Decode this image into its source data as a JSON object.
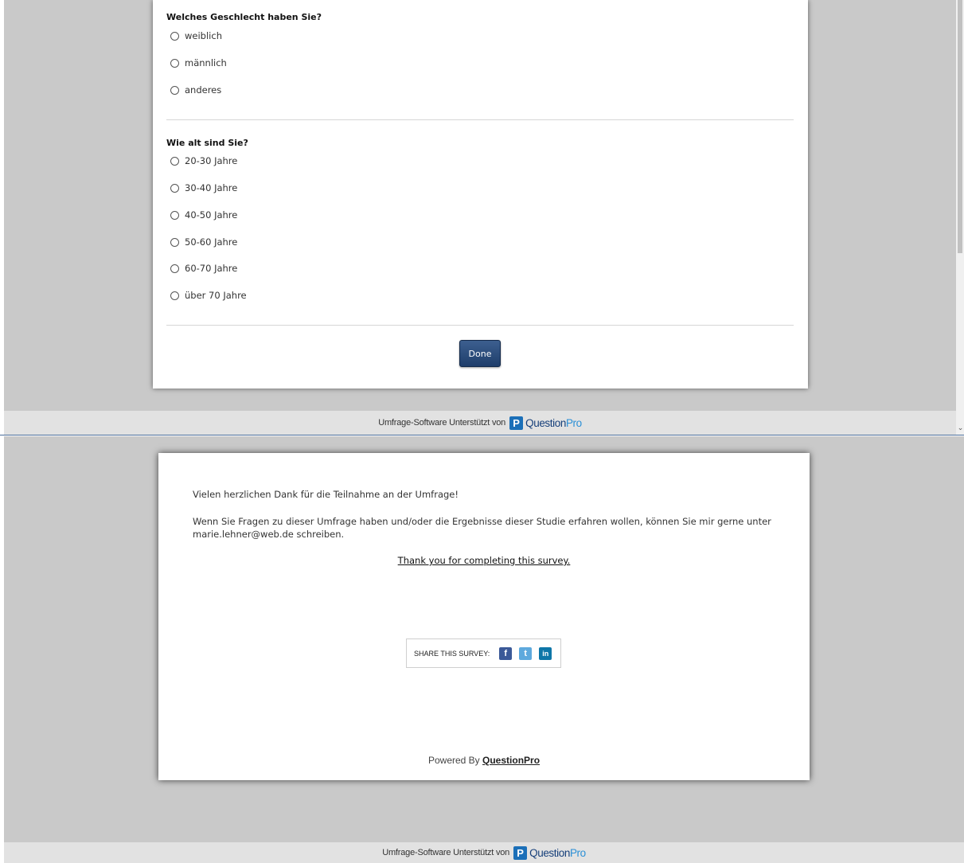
{
  "survey": {
    "gender_question": {
      "title": "Welches Geschlecht haben Sie?",
      "options": [
        "weiblich",
        "männlich",
        "anderes"
      ]
    },
    "age_question": {
      "title": "Wie alt sind Sie?",
      "options": [
        "20-30 Jahre",
        "30-40 Jahre",
        "40-50 Jahre",
        "50-60 Jahre",
        "60-70 Jahre",
        "über 70 Jahre"
      ]
    },
    "done_label": "Done"
  },
  "footer": {
    "text": "Umfrage-Software Unterstützt von",
    "logo_badge": "P",
    "logo_question": "Question",
    "logo_pro": "Pro"
  },
  "thanks": {
    "line1": "Vielen herzlichen Dank für die Teilnahme an der Umfrage!",
    "line2": "Wenn Sie Fragen zu dieser Umfrage haben und/oder die Ergebnisse dieser Studie erfahren wollen, können Sie mir gerne unter",
    "line3": "marie.lehner@web.de schreiben.",
    "completed_link": "Thank you for completing this survey.",
    "share_label": "SHARE THIS SURVEY:",
    "social": [
      {
        "icon": "facebook-icon",
        "glyph": "f",
        "color": "#3b5998"
      },
      {
        "icon": "twitter-icon",
        "glyph": "t",
        "color": "#5ea9dd"
      },
      {
        "icon": "linkedin-icon",
        "glyph": "in",
        "color": "#0e76a8"
      }
    ],
    "powered_prefix": "Powered By",
    "powered_link": "QuestionPro"
  },
  "colors": {
    "page_bg": "#c9c9c9",
    "done_button": "#2b4c7e",
    "logo_dark": "#163f7a",
    "logo_light": "#2a8fd6"
  }
}
